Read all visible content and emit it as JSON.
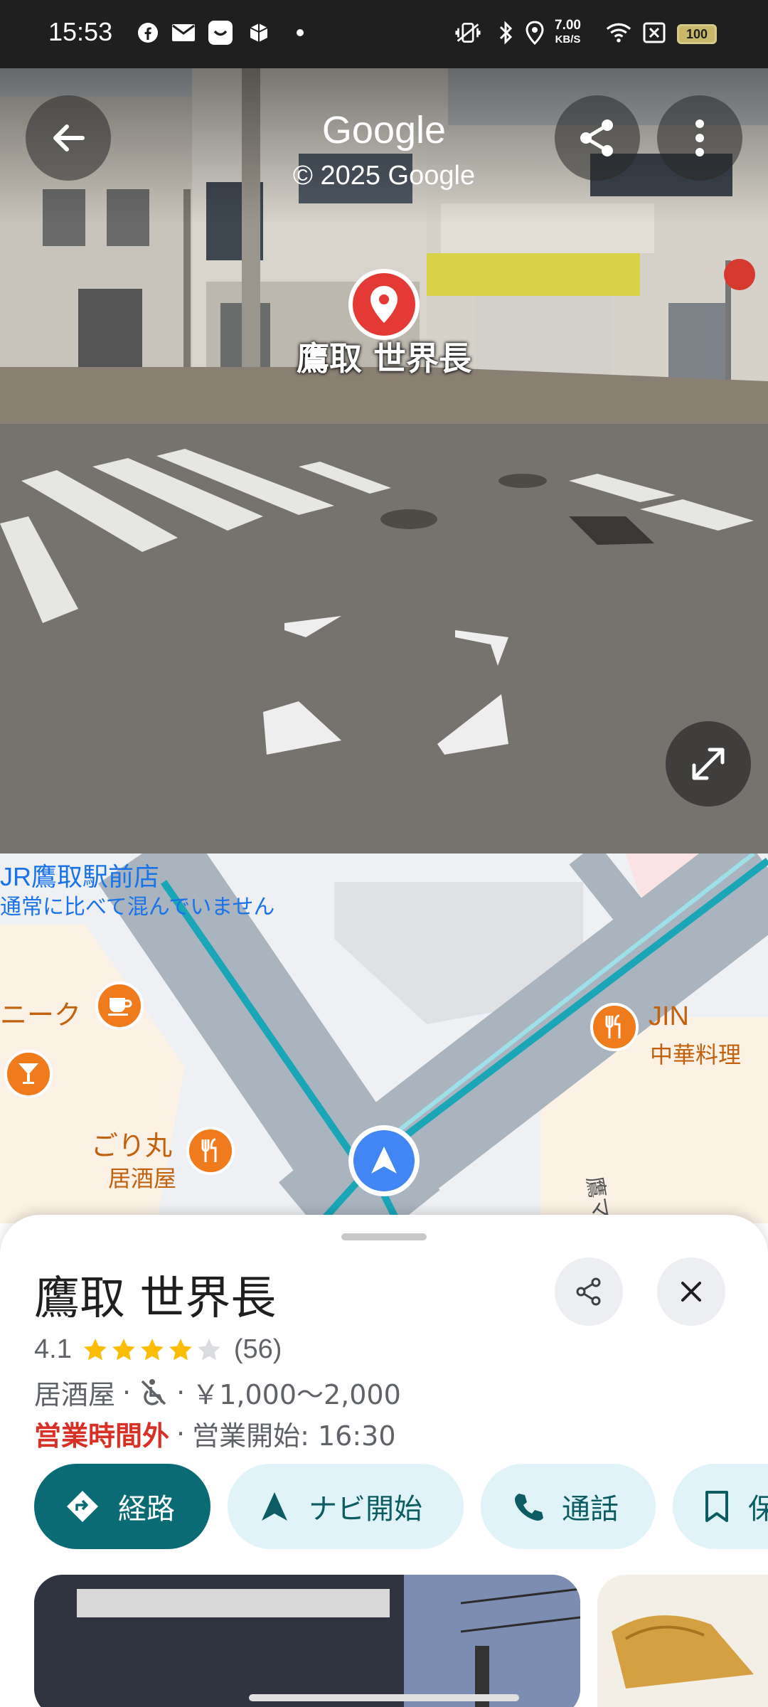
{
  "status_bar": {
    "time": "15:53",
    "speed_value": "7.00",
    "speed_unit": "KB/S",
    "battery": "100",
    "icons": [
      "facebook-icon",
      "mail-icon",
      "app-icon",
      "app-cube-icon",
      "dot-icon",
      "vibrate-icon",
      "bluetooth-icon",
      "location-icon",
      "wifi-icon",
      "sim-icon"
    ]
  },
  "streetview": {
    "title": "Google",
    "copyright": "© 2025 Google",
    "place_label": "鷹取 世界長",
    "colors": {
      "pin": "#e53935"
    }
  },
  "map": {
    "labels": {
      "station_name": "JR鷹取駅前店",
      "station_status": "通常に比べて混んでいません",
      "cafe_name": "ニーク",
      "jin_name": "JIN",
      "jin_type": "中華料理",
      "gorimaru_name": "ごり丸",
      "gorimaru_type": "居酒屋",
      "building_name": "鷹マン"
    },
    "colors": {
      "road": "#aab4bf",
      "route": "#1aa6b7",
      "poi": "#f07b1d",
      "navigation": "#4285f4"
    }
  },
  "sheet": {
    "title": "鷹取 世界長",
    "rating": "4.1",
    "stars_filled": 4,
    "stars_total": 5,
    "reviews": "(56)",
    "category": "居酒屋",
    "separator": "·",
    "price": "￥1,000～2,000",
    "status": "営業時間外",
    "opening": "営業開始: 16:30",
    "actions": [
      {
        "label": "経路",
        "icon": "directions-icon"
      },
      {
        "label": "ナビ開始",
        "icon": "navigation-arrow-icon"
      },
      {
        "label": "通話",
        "icon": "phone-icon"
      },
      {
        "label": "保",
        "icon": "bookmark-icon"
      }
    ],
    "colors": {
      "primary": "#0b6b75",
      "chip": "#dff3f8",
      "star": "#fbbc04",
      "closed": "#d93025"
    }
  }
}
